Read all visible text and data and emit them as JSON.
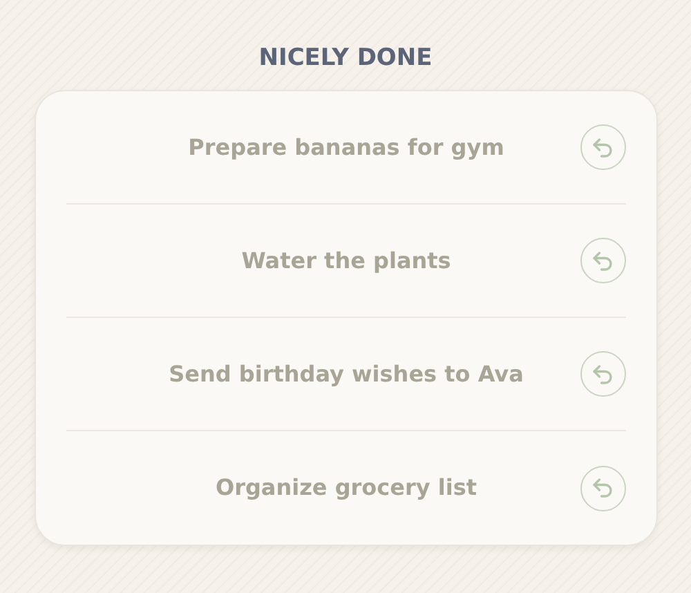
{
  "title": "NICELY DONE",
  "tasks": [
    {
      "label": "Prepare bananas for gym"
    },
    {
      "label": "Water the plants"
    },
    {
      "label": "Send birthday wishes to Ava"
    },
    {
      "label": "Organize grocery list"
    }
  ]
}
